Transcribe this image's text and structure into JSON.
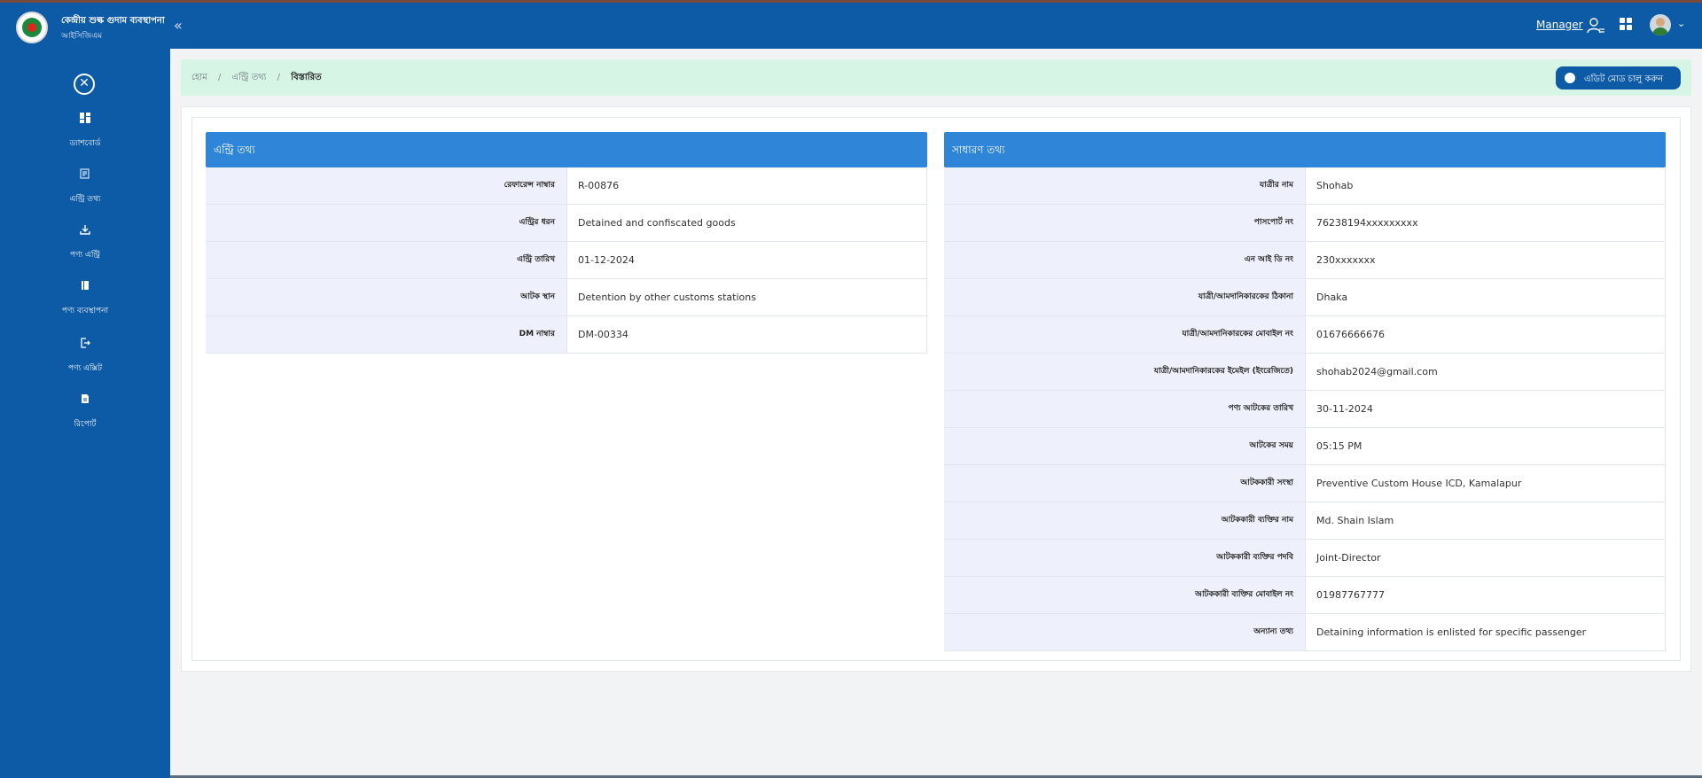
{
  "brand": {
    "title": "কেন্দ্রীয় শুল্ক গুদাম ব্যবস্থাপনা",
    "subtitle": "আইসিজিএম"
  },
  "sidebar": {
    "items": [
      {
        "label": "ড্যাশবোর্ড",
        "icon": "dashboard-icon"
      },
      {
        "label": "এন্ট্রি তথ্য",
        "icon": "entry-info-icon"
      },
      {
        "label": "পণ্য এন্ট্রি",
        "icon": "download-icon"
      },
      {
        "label": "পণ্য ব্যবস্থাপনা",
        "icon": "book-icon"
      },
      {
        "label": "পণ্য এক্সিট",
        "icon": "exit-icon"
      },
      {
        "label": "রিপোর্ট",
        "icon": "report-icon"
      }
    ]
  },
  "header": {
    "role_label": "Manager"
  },
  "breadcrumb": {
    "items": [
      "হোম",
      "এন্ট্রি তথ্য",
      "বিস্তারিত"
    ],
    "separator": "/"
  },
  "edit_toggle": {
    "label": "এডিট মোড চালু করুন"
  },
  "entry_panel": {
    "title": "এন্ট্রি তথ্য",
    "rows": [
      {
        "key": "রেফারেন্স নাম্বার",
        "value": "R-00876"
      },
      {
        "key": "এন্ট্রির ধরন",
        "value": "Detained and confiscated goods"
      },
      {
        "key": "এন্ট্রি তারিখ",
        "value": "01-12-2024"
      },
      {
        "key": "আটক স্থান",
        "value": "Detention by other customs stations"
      },
      {
        "key": "DM নাম্বার",
        "value": "DM-00334"
      }
    ]
  },
  "general_panel": {
    "title": "সাধারণ তথ্য",
    "rows": [
      {
        "key": "যাত্রীর নাম",
        "value": "Shohab"
      },
      {
        "key": "পাসপোর্ট নং",
        "value": "76238194xxxxxxxxx"
      },
      {
        "key": "এন আই ডি নং",
        "value": "230xxxxxxx"
      },
      {
        "key": "যাত্রী/আমদানিকারকের ঠিকানা",
        "value": "Dhaka"
      },
      {
        "key": "যাত্রী/আমদানিকারকের মোবাইল নং",
        "value": "01676666676"
      },
      {
        "key": "যাত্রী/আমদানিকারকের ইমেইল (ইংরেজিতে)",
        "value": "shohab2024@gmail.com"
      },
      {
        "key": "পণ্য আটকের তারিখ",
        "value": "30-11-2024"
      },
      {
        "key": "আটকের সময়",
        "value": "05:15 PM"
      },
      {
        "key": "আটককারী সংস্থা",
        "value": "Preventive Custom House ICD, Kamalapur"
      },
      {
        "key": "আটককারী ব্যক্তির নাম",
        "value": "Md. Shain Islam"
      },
      {
        "key": "আটককারী ব্যক্তির পদবি",
        "value": "Joint-Director"
      },
      {
        "key": "আটককারী ব্যক্তির মোবাইল নং",
        "value": "01987767777"
      },
      {
        "key": "অন্যান্য তথ্য",
        "value": "Detaining information is enlisted for specific passenger"
      }
    ]
  }
}
